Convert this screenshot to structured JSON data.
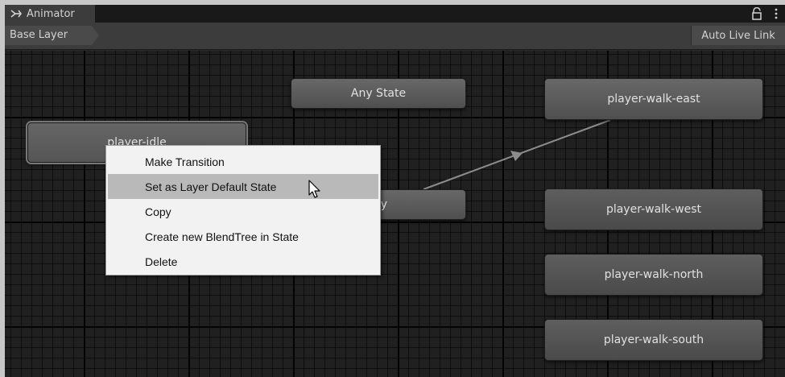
{
  "window": {
    "tab_title": "Animator",
    "tab_icon": "animator-icon",
    "tools": [
      "lock-icon",
      "kebab-menu-icon"
    ]
  },
  "toolbar": {
    "breadcrumb": "Base Layer",
    "auto_live_link": "Auto Live Link"
  },
  "graph": {
    "states": {
      "any_state": "Any State",
      "player_idle": "player-idle",
      "entry_fragment": "ry",
      "walk_east": "player-walk-east",
      "walk_west": "player-walk-west",
      "walk_north": "player-walk-north",
      "walk_south": "player-walk-south"
    }
  },
  "context_menu": {
    "items": [
      "Make Transition",
      "Set as Layer Default State",
      "Copy",
      "Create new BlendTree in State",
      "Delete"
    ],
    "hovered_index": 1
  },
  "colors": {
    "graph_bg": "#202020",
    "node": "#5a5a5a",
    "transition": "#8c8c8c",
    "menu_bg": "#f2f2f2",
    "menu_hover": "#b9b9b9"
  }
}
